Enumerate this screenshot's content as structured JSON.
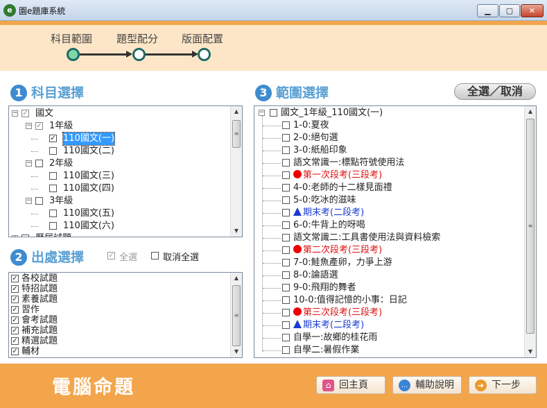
{
  "window": {
    "title": "園e題庫系統",
    "app_icon": "e",
    "minimize_glyph": "▁",
    "maximize_glyph": "▢",
    "close_glyph": "✕"
  },
  "stepper": {
    "steps": [
      "科目範圍",
      "題型配分",
      "版面配置"
    ],
    "active_index": 0
  },
  "section1": {
    "number": "1",
    "title": "科目選擇"
  },
  "section2": {
    "number": "2",
    "title": "出處選擇",
    "select_all": "全選",
    "unselect_all": "取消全選"
  },
  "section3": {
    "number": "3",
    "title": "範圍選擇",
    "toggle_all": "全選／取消"
  },
  "subject_tree": [
    {
      "label": "國文",
      "depth": 0,
      "expander": "−",
      "checked": "partial"
    },
    {
      "label": "1年級",
      "depth": 1,
      "expander": "−",
      "checked": "partial"
    },
    {
      "label": "110國文(一)",
      "depth": 2,
      "expander": "",
      "checked": "checked",
      "selected": true
    },
    {
      "label": "110國文(二)",
      "depth": 2,
      "expander": "",
      "checked": "unchecked"
    },
    {
      "label": "2年級",
      "depth": 1,
      "expander": "−",
      "checked": "unchecked"
    },
    {
      "label": "110國文(三)",
      "depth": 2,
      "expander": "",
      "checked": "unchecked"
    },
    {
      "label": "110國文(四)",
      "depth": 2,
      "expander": "",
      "checked": "unchecked"
    },
    {
      "label": "3年級",
      "depth": 1,
      "expander": "−",
      "checked": "unchecked"
    },
    {
      "label": "110國文(五)",
      "depth": 2,
      "expander": "",
      "checked": "unchecked"
    },
    {
      "label": "110國文(六)",
      "depth": 2,
      "expander": "",
      "checked": "unchecked"
    },
    {
      "label": "歷屆試題",
      "depth": 0,
      "expander": "+",
      "checked": "unchecked"
    }
  ],
  "source_list": [
    "各校試題",
    "特招試題",
    "素養試題",
    "習作",
    "會考試題",
    "補充試題",
    "精選試題",
    "輔材"
  ],
  "range_tree": {
    "root": "國文_1年級_110國文(一)",
    "items": [
      {
        "label": "1-0:夏夜",
        "style": "normal"
      },
      {
        "label": "2-0:絕句選",
        "style": "normal"
      },
      {
        "label": "3-0:紙船印象",
        "style": "normal"
      },
      {
        "label": "語文常識一:標點符號使用法",
        "style": "normal"
      },
      {
        "label": "第一次段考(三段考)",
        "style": "red"
      },
      {
        "label": "4-0:老師的十二樣見面禮",
        "style": "normal"
      },
      {
        "label": "5-0:吃冰的滋味",
        "style": "normal"
      },
      {
        "label": "期末考(二段考)",
        "style": "blue"
      },
      {
        "label": "6-0:牛背上的呀喝",
        "style": "normal"
      },
      {
        "label": "語文常識二:工具書使用法與資料檢索",
        "style": "normal"
      },
      {
        "label": "第二次段考(三段考)",
        "style": "red"
      },
      {
        "label": "7-0:鮭魚產卵，力爭上游",
        "style": "normal"
      },
      {
        "label": "8-0:論語選",
        "style": "normal"
      },
      {
        "label": "9-0:飛翔的舞者",
        "style": "normal"
      },
      {
        "label": "10-0:值得記憶的小事：日記",
        "style": "normal"
      },
      {
        "label": "第三次段考(三段考)",
        "style": "red"
      },
      {
        "label": "期末考(二段考)",
        "style": "blue"
      },
      {
        "label": "自學一:故鄉的桂花雨",
        "style": "normal"
      },
      {
        "label": "自學二:暑假作業",
        "style": "normal"
      }
    ]
  },
  "footer": {
    "title": "電腦命題",
    "home": "回主頁",
    "help": "輔助說明",
    "next": "下一步"
  },
  "colors": {
    "accent_orange": "#f3a54b",
    "section_blue": "#5aa0d4",
    "step_teal": "#1f6b66",
    "exam_red": "#dd1111",
    "exam_blue": "#1a3bd1"
  }
}
